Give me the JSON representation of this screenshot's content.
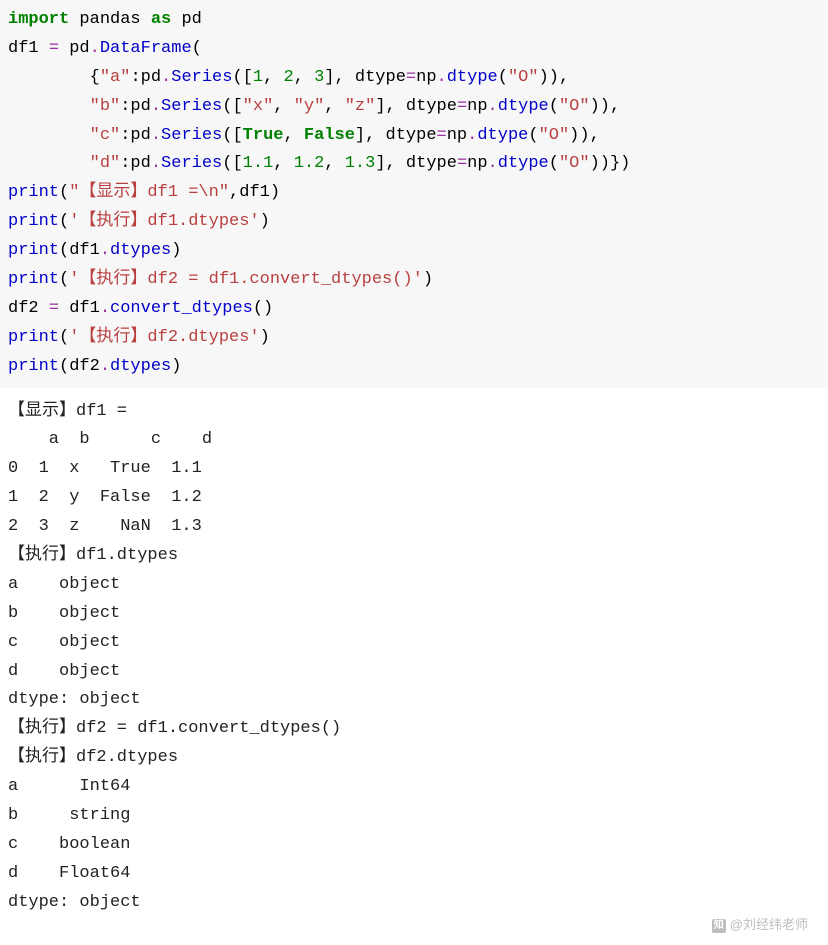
{
  "code": {
    "l1": {
      "t1": "import",
      "t2": " pandas ",
      "t3": "as",
      "t4": " pd"
    },
    "l2": {
      "t1": "df1 ",
      "t2": "=",
      "t3": " pd",
      "t4": ".",
      "t5": "DataFrame",
      "t6": "("
    },
    "l3": {
      "pad": "        ",
      "t1": "{",
      "t2": "\"a\"",
      "t3": ":pd",
      "t4": ".",
      "t5": "Series",
      "t6": "([",
      "t7": "1",
      "t8": ", ",
      "t9": "2",
      "t10": ", ",
      "t11": "3",
      "t12": "], dtype",
      "t13": "=",
      "t14": "np",
      "t15": ".",
      "t16": "dtype",
      "t17": "(",
      "t18": "\"O\"",
      "t19": ")),"
    },
    "l4": {
      "pad": "        ",
      "t1": "\"b\"",
      "t2": ":pd",
      "t3": ".",
      "t4": "Series",
      "t5": "([",
      "t6": "\"x\"",
      "t7": ", ",
      "t8": "\"y\"",
      "t9": ", ",
      "t10": "\"z\"",
      "t11": "], dtype",
      "t12": "=",
      "t13": "np",
      "t14": ".",
      "t15": "dtype",
      "t16": "(",
      "t17": "\"O\"",
      "t18": ")),"
    },
    "l5": {
      "pad": "        ",
      "t1": "\"c\"",
      "t2": ":pd",
      "t3": ".",
      "t4": "Series",
      "t5": "([",
      "t6": "True",
      "t7": ", ",
      "t8": "False",
      "t9": "], dtype",
      "t10": "=",
      "t11": "np",
      "t12": ".",
      "t13": "dtype",
      "t14": "(",
      "t15": "\"O\"",
      "t16": ")),"
    },
    "l6": {
      "pad": "        ",
      "t1": "\"d\"",
      "t2": ":pd",
      "t3": ".",
      "t4": "Series",
      "t5": "([",
      "t6": "1.1",
      "t7": ", ",
      "t8": "1.2",
      "t9": ", ",
      "t10": "1.3",
      "t11": "], dtype",
      "t12": "=",
      "t13": "np",
      "t14": ".",
      "t15": "dtype",
      "t16": "(",
      "t17": "\"O\"",
      "t18": "))})"
    },
    "l7": {
      "t1": "print",
      "t2": "(",
      "t3": "\"【显示】df1 =\\n\"",
      "t4": ",df1)"
    },
    "l8": {
      "t1": "print",
      "t2": "(",
      "t3": "'【执行】df1.dtypes'",
      "t4": ")"
    },
    "l9": {
      "t1": "print",
      "t2": "(df1",
      "t3": ".",
      "t4": "dtypes",
      "t5": ")"
    },
    "l10": {
      "t1": "print",
      "t2": "(",
      "t3": "'【执行】df2 = df1.convert_dtypes()'",
      "t4": ")"
    },
    "l11": {
      "t1": "df2 ",
      "t2": "=",
      "t3": " df1",
      "t4": ".",
      "t5": "convert_dtypes",
      "t6": "()"
    },
    "l12": {
      "t1": "print",
      "t2": "(",
      "t3": "'【执行】df2.dtypes'",
      "t4": ")"
    },
    "l13": {
      "t1": "print",
      "t2": "(df2",
      "t3": ".",
      "t4": "dtypes",
      "t5": ")"
    }
  },
  "output": {
    "o1": "【显示】df1 =",
    "o2": "    a  b      c    d",
    "o3": "0  1  x   True  1.1",
    "o4": "1  2  y  False  1.2",
    "o5": "2  3  z    NaN  1.3",
    "o6": "【执行】df1.dtypes",
    "o7": "a    object",
    "o8": "b    object",
    "o9": "c    object",
    "o10": "d    object",
    "o11": "dtype: object",
    "o12": "【执行】df2 = df1.convert_dtypes()",
    "o13": "【执行】df2.dtypes",
    "o14": "a      Int64",
    "o15": "b     string",
    "o16": "c    boolean",
    "o17": "d    Float64",
    "o18": "dtype: object"
  },
  "watermark": {
    "icon": "知",
    "text": "@刘经纬老师"
  }
}
